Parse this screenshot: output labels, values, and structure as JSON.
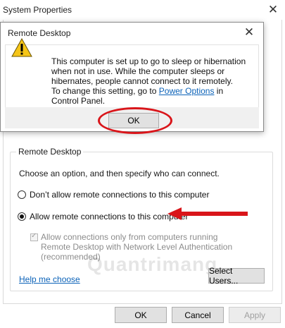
{
  "system_properties": {
    "title": "System Properties",
    "close_glyph": "✕",
    "group_label": "Remote Desktop",
    "group_description": "Choose an option, and then specify who can connect.",
    "radio_dont_allow": "Don’t allow remote connections to this computer",
    "radio_allow": "Allow remote connections to this computer",
    "nla_checkbox_label": "Allow connections only from computers running Remote Desktop with Network Level Authentication (recommended)",
    "help_link": "Help me choose",
    "select_users_button": "Select Users...",
    "ok_button": "OK",
    "cancel_button": "Cancel",
    "apply_button": "Apply",
    "watermark": "Quantrimang"
  },
  "dialog": {
    "title": "Remote Desktop",
    "close_glyph": "✕",
    "message_line_1": "This computer is set up to go to sleep or hibernation when not in use. While the computer sleeps or hibernates, people cannot connect to it remotely.",
    "message_line_2_before": "To change this setting, go to ",
    "message_link": "Power Options",
    "message_line_2_after": " in Control Panel.",
    "ok_button": "OK",
    "icon": "warning-icon"
  },
  "colors": {
    "annotation_red": "#d9151a",
    "link_blue": "#0b62b8",
    "warning_yellow": "#f5c518"
  }
}
